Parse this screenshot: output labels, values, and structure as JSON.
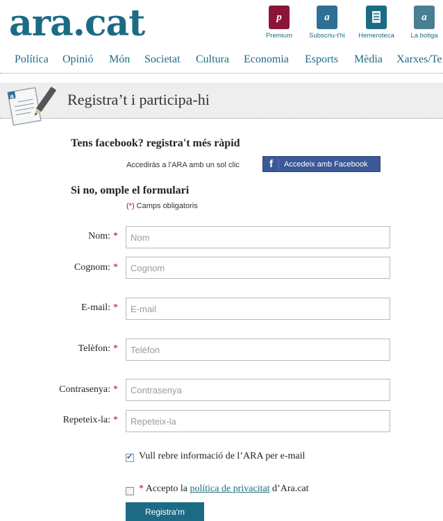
{
  "header": {
    "logo": "ara.cat",
    "services": [
      {
        "label": "Premium",
        "glyph": "p",
        "color": "#8a1538",
        "icon": "premium-icon"
      },
      {
        "label": "Subscriu-t'hi",
        "glyph": "a",
        "color": "#2f6f95",
        "icon": "subscribe-icon"
      },
      {
        "label": "Hemeroteca",
        "glyph": "",
        "color": "#1c6b85",
        "icon": "archive-icon"
      },
      {
        "label": "La botiga",
        "glyph": "a",
        "color": "#4a7e95",
        "icon": "shop-icon"
      }
    ]
  },
  "nav": [
    "Política",
    "Opinió",
    "Món",
    "Societat",
    "Cultura",
    "Economia",
    "Esports",
    "Mèdia",
    "Xarxes/Te"
  ],
  "page": {
    "title": "Registra’t i participa-hi"
  },
  "facebook": {
    "heading": "Tens facebook? registra't més ràpid",
    "hint": "Accediràs a l'ARA amb un sol clic",
    "button_label": "Accedeix amb Facebook",
    "button_icon": "f"
  },
  "form": {
    "heading": "Si no, omple el formulari",
    "required_marker": "(*)",
    "required_note": " Camps obligatoris",
    "fields": [
      {
        "label": "Nom:",
        "placeholder": "Nom"
      },
      {
        "label": "Cognom:",
        "placeholder": "Cognom"
      },
      {
        "label": "E-mail:",
        "placeholder": "E-mail"
      },
      {
        "label": "Telèfon:",
        "placeholder": "Telèfon"
      },
      {
        "label": "Contrasenya:",
        "placeholder": "Contrasenya"
      },
      {
        "label": "Repeteix-la:",
        "placeholder": "Repeteix-la"
      }
    ],
    "required_star": "*",
    "newsletter": {
      "label": "Vull rebre informació de l’ARA per e-mail",
      "checked": true
    },
    "privacy": {
      "prefix": " Accepto la ",
      "link": "política de privacitat",
      "suffix": " d’Ara.cat",
      "checked": false
    },
    "submit_label": "Registra'm"
  },
  "colors": {
    "brand": "#1c6b85",
    "facebook": "#3b5998",
    "required": "#cc0000"
  }
}
